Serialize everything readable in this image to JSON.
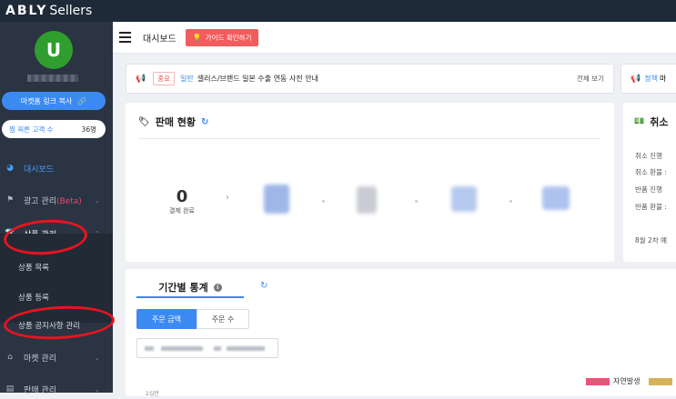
{
  "brand": {
    "logo_main": "ABLY",
    "logo_sub": "Sellers"
  },
  "profile": {
    "avatar_letter": "U"
  },
  "sidebar": {
    "market_link_btn": "마켓홈 링크 복사",
    "market_link_icon": "link-icon",
    "favorite_label": "찜 찌른 고객 수",
    "favorite_count": "36명",
    "items": [
      {
        "label": "대시보드",
        "icon": "dashboard-icon"
      },
      {
        "label": "광고 관리",
        "badge": "(Beta)",
        "icon": "flag-icon"
      },
      {
        "label": "상품 관리",
        "icon": "tshirt-icon"
      },
      {
        "label": "마켓 관리",
        "icon": "home-icon"
      },
      {
        "label": "판매 관리",
        "icon": "document-icon"
      }
    ],
    "sub_items": [
      "상품 목록",
      "상품 등록",
      "상품 공지사항 관리"
    ]
  },
  "header": {
    "title": "대시보드",
    "guide_btn": "가이드 확인하기"
  },
  "notice": {
    "tag": "중요",
    "category": "일반",
    "text": "셀러스/브랜드 일본 수출 연동 사전 안내",
    "view_all": "전체 보기"
  },
  "notice2": {
    "category": "정책",
    "text": "마"
  },
  "sales": {
    "title": "판매 현황",
    "payment_done_value": "0",
    "payment_done_label": "결제 완료"
  },
  "cancel": {
    "title": "취소",
    "rows": [
      "취소 진행",
      "취소 환불 :",
      "반품 진행",
      "반품 환불 :"
    ],
    "week": "8월 2차 예"
  },
  "period": {
    "title": "기간별 통계",
    "tabs": [
      "주문 금액",
      "주문 수"
    ],
    "legend_organic": "자연발생",
    "y_tick": "2십만"
  },
  "colors": {
    "accent": "#3b8af2",
    "topbar": "#1f2a38",
    "sidebar": "#2b3443",
    "guide_btn": "#f25c5c",
    "annotation_circle": "#e8141e",
    "legend_organic": "#e8537a"
  }
}
